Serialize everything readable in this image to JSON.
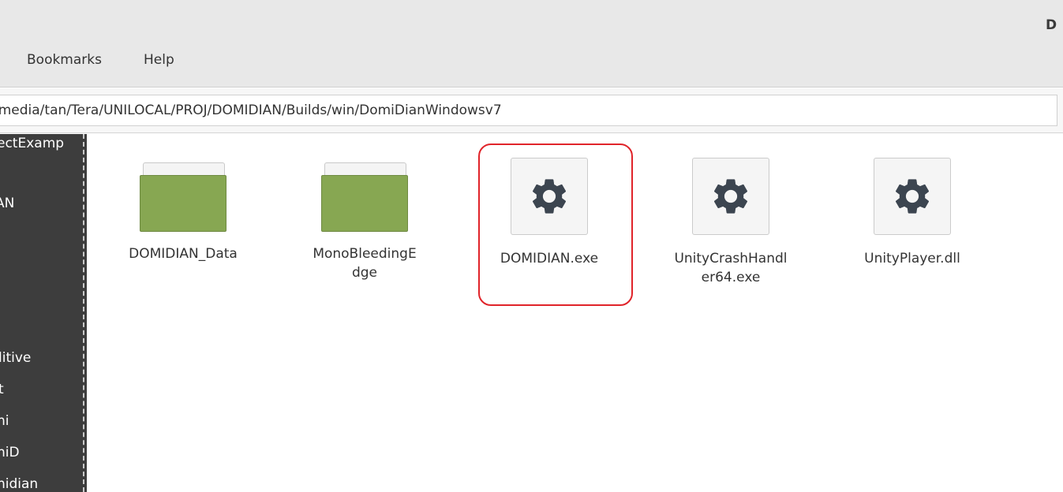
{
  "window": {
    "title": "D"
  },
  "menubar": {
    "items": [
      {
        "label": "Bookmarks"
      },
      {
        "label": "Help"
      }
    ]
  },
  "location": {
    "path": "/media/tan/Tera/UNILOCAL/PROJ/DOMIDIAN/Builds/win/DomiDianWindowsv7"
  },
  "sidebar": {
    "items": [
      {
        "label": "ectExamp"
      },
      {
        "label": "AN"
      },
      {
        "label": "litive"
      },
      {
        "label": "t"
      },
      {
        "label": "ni"
      },
      {
        "label": "niD"
      },
      {
        "label": "nidian"
      }
    ]
  },
  "files": [
    {
      "name": "DOMIDIAN_Data",
      "type": "folder",
      "icon": "folder-icon"
    },
    {
      "name": "MonoBleedingEdge",
      "type": "folder",
      "icon": "folder-icon"
    },
    {
      "name": "DOMIDIAN.exe",
      "type": "executable",
      "icon": "gear-icon",
      "highlighted": true
    },
    {
      "name": "UnityCrashHandler64.exe",
      "type": "executable",
      "icon": "gear-icon"
    },
    {
      "name": "UnityPlayer.dll",
      "type": "library",
      "icon": "gear-icon"
    }
  ],
  "colors": {
    "folder": "#87a752",
    "sidebar_bg": "#3d3d3d",
    "highlight": "#e0242a",
    "gear": "#3c4550"
  }
}
